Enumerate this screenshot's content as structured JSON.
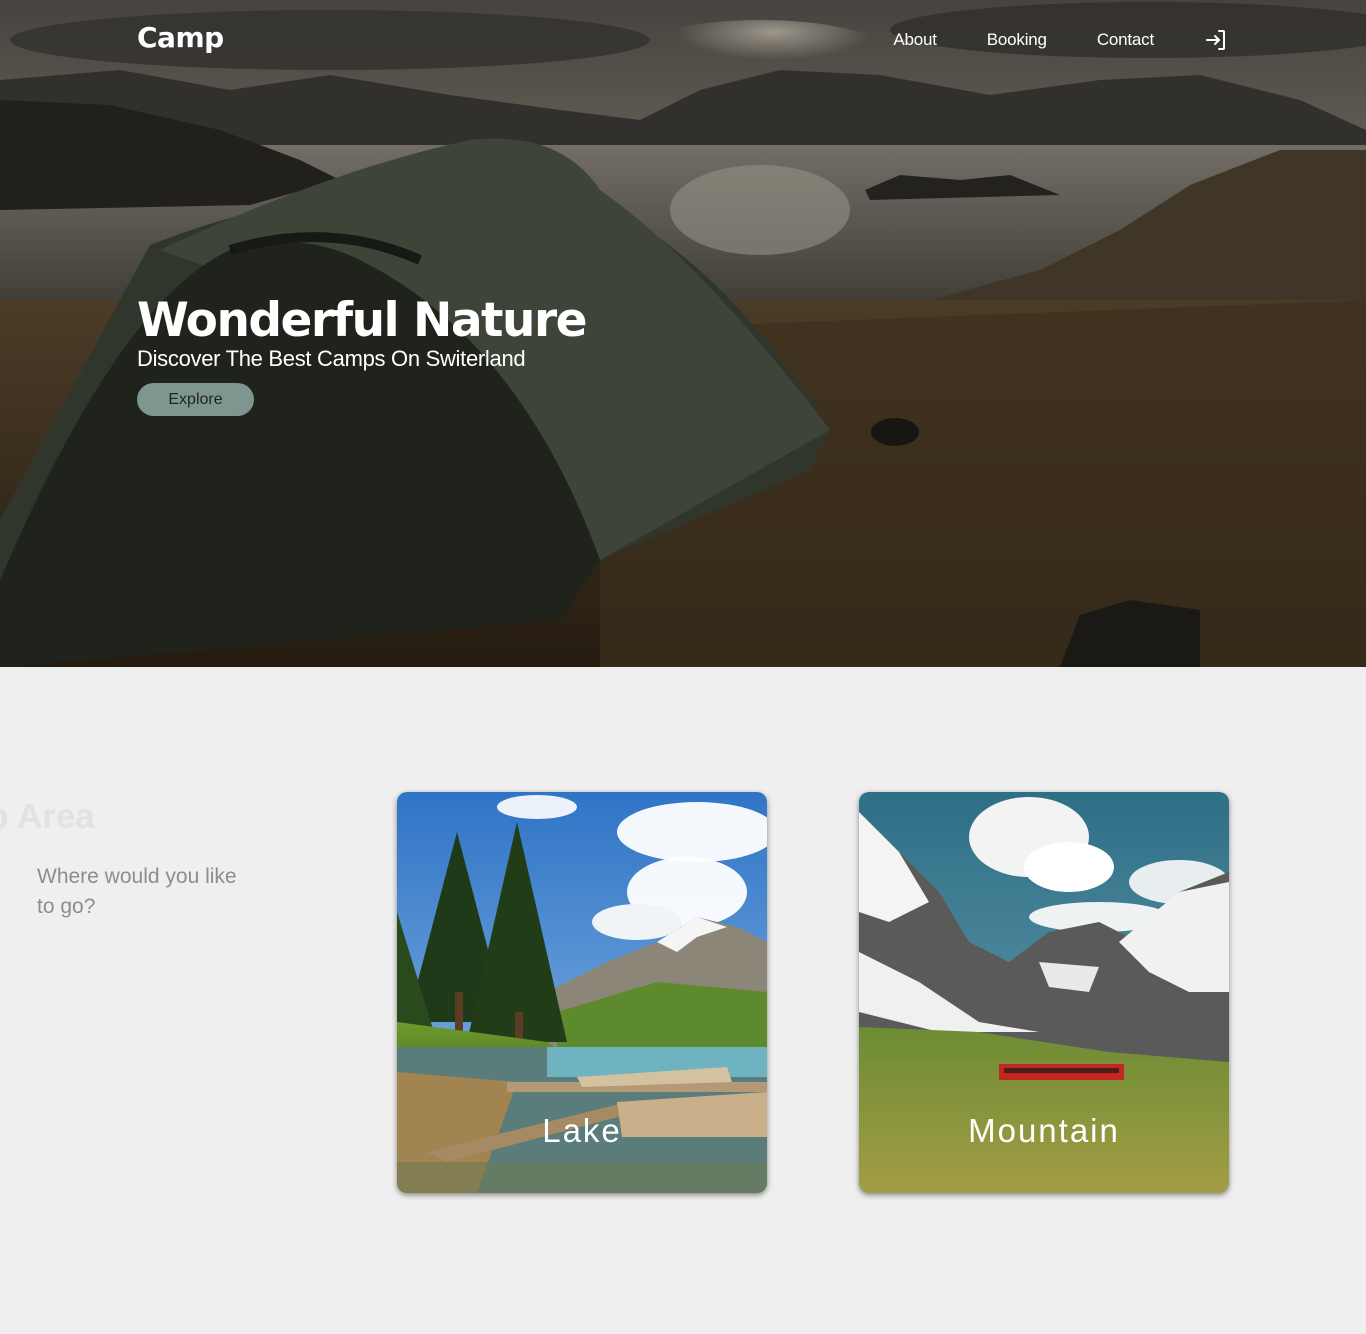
{
  "header": {
    "logo": "Camp",
    "nav": [
      {
        "label": "About"
      },
      {
        "label": "Booking"
      },
      {
        "label": "Contact"
      }
    ],
    "login_icon": "login-arrow-icon"
  },
  "hero": {
    "title": "Wonderful Nature",
    "subtitle": "Discover The Best Camps On Switerland",
    "cta_label": "Explore"
  },
  "camp_area": {
    "title": "mp Area",
    "subtitle": "Where would you like to go?",
    "cards": [
      {
        "label": "Lake"
      },
      {
        "label": "Mountain"
      }
    ]
  },
  "colors": {
    "page_bg": "#efefef",
    "button_bg": "#7f9590",
    "text_light": "#ffffff",
    "subtitle_gray": "#8d8d8d"
  }
}
